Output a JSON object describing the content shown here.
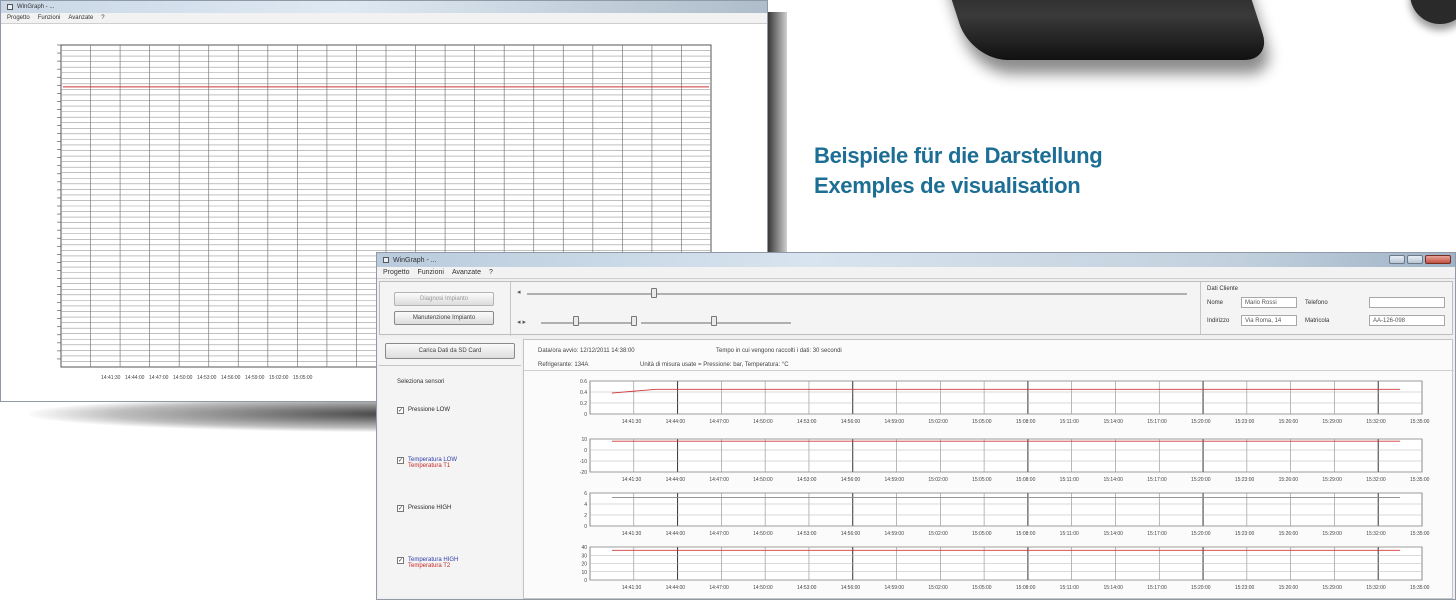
{
  "caption": {
    "line1": "Beispiele für die Darstellung",
    "line2": "Exemples de visualisation"
  },
  "window1": {
    "title": "WinGraph - ...",
    "menu": [
      "Progetto",
      "Funzioni",
      "Avanzate",
      "?"
    ],
    "chart": {
      "x_ticks": [
        "14:41:30",
        "14:44:00",
        "14:47:00",
        "14:50:00",
        "14:53:00",
        "14:56:00",
        "14:59:00",
        "15:02:00",
        "15:05:00"
      ]
    }
  },
  "window2": {
    "title": "WinGraph - ...",
    "menu": [
      "Progetto",
      "Funzioni",
      "Avanzate",
      "?"
    ],
    "buttons": {
      "diagnosi": "Diagnosi Impianto",
      "manutenzione": "Manutenzione Impianto",
      "carica": "Carica Dati da SD Card"
    },
    "client": {
      "section_title": "Dati Cliente",
      "nome_label": "Nome",
      "nome_value": "Mario Rossi",
      "telefono_label": "Telefono",
      "telefono_value": "",
      "indirizzo_label": "Indirizzo",
      "indirizzo_value": "Via Roma, 14",
      "matricola_label": "Matricola",
      "matricola_value": "AA-126-098"
    },
    "info": {
      "data_line": "Data/ora avvio: 12/12/2011 14:38:00",
      "tempo_line": "Tempo in cui vengono raccolti i dati: 30 secondi",
      "refrigerante_line": "Refrigerante: 134A",
      "unita_line": "Unità di misura usate = Pressione: bar, Temperatura: °C"
    },
    "selection": {
      "title": "Seleziona sensori",
      "items": [
        {
          "primary": "Pressione LOW",
          "secondary": ""
        },
        {
          "primary": "Temperatura LOW",
          "secondary": "Temperatura T1"
        },
        {
          "primary": "Pressione HIGH",
          "secondary": ""
        },
        {
          "primary": "Temperatura HIGH",
          "secondary": "Temperatura T2"
        }
      ]
    },
    "x_ticks": [
      "14:41:30",
      "14:44:00",
      "14:47:00",
      "14:50:00",
      "14:53:00",
      "14:56:00",
      "14:59:00",
      "15:02:00",
      "15:05:00",
      "15:08:00",
      "15:11:00",
      "15:14:00",
      "15:17:00",
      "15:20:00",
      "15:23:00",
      "15:26:00",
      "15:29:00",
      "15:32:00",
      "15:35:00"
    ]
  },
  "chart_data": [
    {
      "type": "line",
      "panel": "window1",
      "series": [
        {
          "color": "#c93030",
          "level": 0.87
        }
      ]
    },
    {
      "type": "line",
      "panel": "subchart-1",
      "y_ticks": [
        "0.6",
        "0.4",
        "0.2",
        "0"
      ],
      "ylim": [
        0,
        0.6
      ],
      "series": [
        {
          "color": "#d03a3a",
          "values": [
            0.38,
            0.45,
            0.45,
            0.45,
            0.45,
            0.45,
            0.45,
            0.45,
            0.45,
            0.45,
            0.45,
            0.45,
            0.45,
            0.45,
            0.45,
            0.45,
            0.45,
            0.45,
            0.45
          ]
        }
      ]
    },
    {
      "type": "line",
      "panel": "subchart-2",
      "y_ticks": [
        "10",
        "0",
        "-10",
        "-20"
      ],
      "ylim": [
        -20,
        10
      ],
      "series": [
        {
          "color": "#d03a3a",
          "values": [
            8,
            8,
            8,
            8,
            8,
            8,
            8,
            8,
            8,
            8,
            8,
            8,
            8,
            8,
            8,
            8,
            8,
            8,
            8
          ]
        }
      ]
    },
    {
      "type": "line",
      "panel": "subchart-3",
      "y_ticks": [
        "6",
        "4",
        "2",
        "0"
      ],
      "ylim": [
        0,
        6
      ],
      "series": [
        {
          "color": "#888888",
          "values": [
            5.2,
            5.2,
            5.2,
            5.2,
            5.2,
            5.2,
            5.2,
            5.2,
            5.2,
            5.2,
            5.2,
            5.2,
            5.2,
            5.2,
            5.2,
            5.2,
            5.2,
            5.2,
            5.2
          ]
        }
      ]
    },
    {
      "type": "line",
      "panel": "subchart-4",
      "y_ticks": [
        "40",
        "30",
        "20",
        "10",
        "0"
      ],
      "ylim": [
        0,
        40
      ],
      "series": [
        {
          "color": "#d03a3a",
          "values": [
            36,
            36,
            36,
            36,
            36,
            36,
            36,
            36,
            36,
            36,
            36,
            36,
            36,
            36,
            36,
            36,
            36,
            36,
            36
          ]
        }
      ]
    }
  ]
}
